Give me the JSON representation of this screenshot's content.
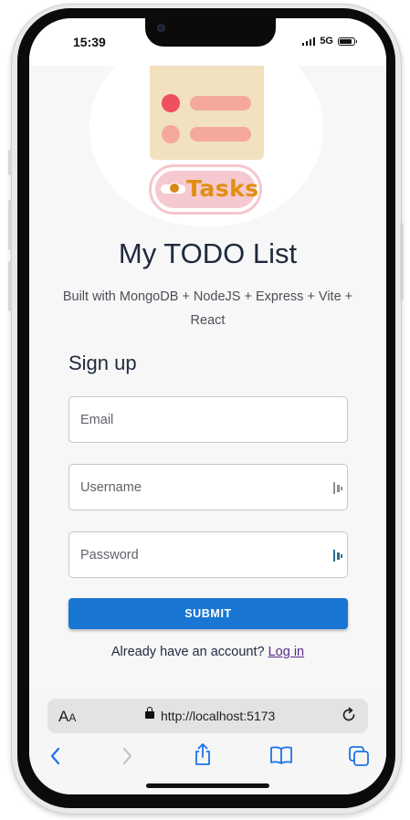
{
  "status_bar": {
    "time": "15:39",
    "network": "5G"
  },
  "logo": {
    "text": "Tasks"
  },
  "app": {
    "title": "My TODO List",
    "subtitle": "Built with MongoDB + NodeJS + Express + Vite + React"
  },
  "form": {
    "heading": "Sign up",
    "email_placeholder": "Email",
    "username_placeholder": "Username",
    "password_placeholder": "Password",
    "submit_label": "SUBMIT",
    "login_prompt": "Already have an account?",
    "login_link": "Log in"
  },
  "browser": {
    "aa_large": "A",
    "aa_small": "A",
    "url": "http://localhost:5173"
  },
  "icons": {
    "status": [
      "signal-icon",
      "battery-icon"
    ],
    "logo": [
      "checklist-illustration",
      "toggle-icon"
    ],
    "fields": [
      "password-manager-key-icon"
    ],
    "browser": [
      "lock-icon",
      "reload-icon",
      "back-icon",
      "forward-icon",
      "share-icon",
      "bookmarks-icon",
      "tabs-icon"
    ]
  },
  "colors": {
    "accent": "#1976d2",
    "title_text": "#1f2a3d",
    "link": "#5a2a8a",
    "dot_teal": "#1f8c7f",
    "dot_red": "#ef4f5e",
    "dot_peach": "#f4a99c",
    "card": "#f2e1bf",
    "pill_text": "#e18f10"
  }
}
